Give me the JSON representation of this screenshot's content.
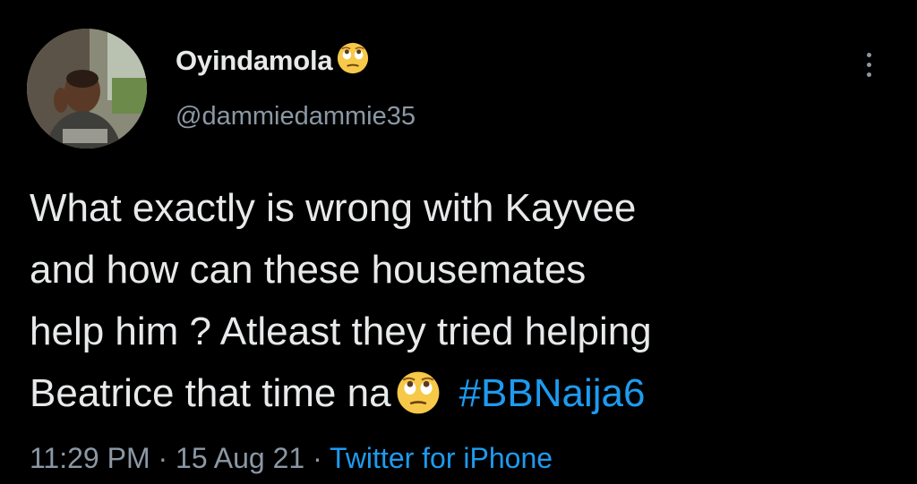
{
  "author": {
    "display_name": "Oyindamola",
    "name_emoji": "face-with-rolling-eyes",
    "handle": "@dammiedammie35"
  },
  "tweet": {
    "lines": [
      "What exactly is wrong with Kayvee",
      "and how can these housemates",
      "help him ? Atleast they tried helping",
      "Beatrice that time na"
    ],
    "inline_emoji": "face-with-rolling-eyes",
    "hashtag": "#BBNaija6"
  },
  "meta": {
    "time": "11:29 PM",
    "separator": "·",
    "date": "15 Aug 21",
    "source": "Twitter for iPhone"
  },
  "colors": {
    "background": "#000000",
    "primary_text": "#e7e9ea",
    "secondary_text": "#8b98a5",
    "link": "#1d9bf0"
  }
}
